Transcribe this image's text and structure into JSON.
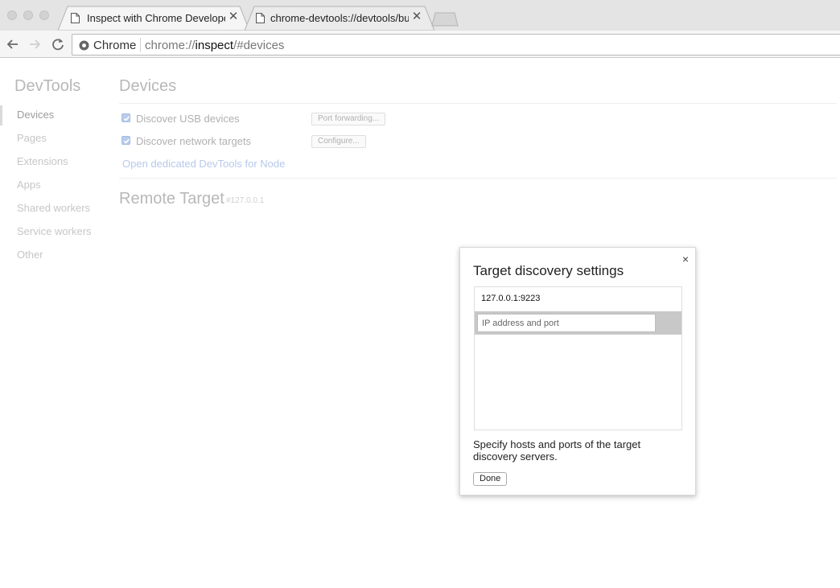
{
  "browser": {
    "tabs": [
      {
        "title": "Inspect with Chrome Developer Tools",
        "active": true
      },
      {
        "title": "chrome-devtools://devtools/bundled/inspector.html",
        "active": false
      }
    ],
    "omnibox": {
      "chip": "Chrome",
      "url_scheme": "chrome://",
      "url_host": "inspect",
      "url_rest": "/#devices"
    }
  },
  "sidebar": {
    "title": "DevTools",
    "items": [
      {
        "label": "Devices"
      },
      {
        "label": "Pages"
      },
      {
        "label": "Extensions"
      },
      {
        "label": "Apps"
      },
      {
        "label": "Shared workers"
      },
      {
        "label": "Service workers"
      },
      {
        "label": "Other"
      }
    ]
  },
  "main": {
    "title": "Devices",
    "options": [
      {
        "label": "Discover USB devices",
        "checked": true,
        "button": "Port forwarding..."
      },
      {
        "label": "Discover network targets",
        "checked": true,
        "button": "Configure..."
      }
    ],
    "node_link": "Open dedicated DevTools for Node",
    "remote_title": "Remote Target",
    "remote_sub": "#127.0.0.1"
  },
  "modal": {
    "title": "Target discovery settings",
    "close_glyph": "×",
    "entries": [
      "127.0.0.1:9223"
    ],
    "input_placeholder": "IP address and port",
    "help_text": "Specify hosts and ports of the target discovery servers.",
    "done_label": "Done"
  },
  "colors": {
    "accent_link": "#b7c9ea",
    "checkbox": "#b9ccec",
    "edit_row_bg": "#c8c8c8"
  }
}
